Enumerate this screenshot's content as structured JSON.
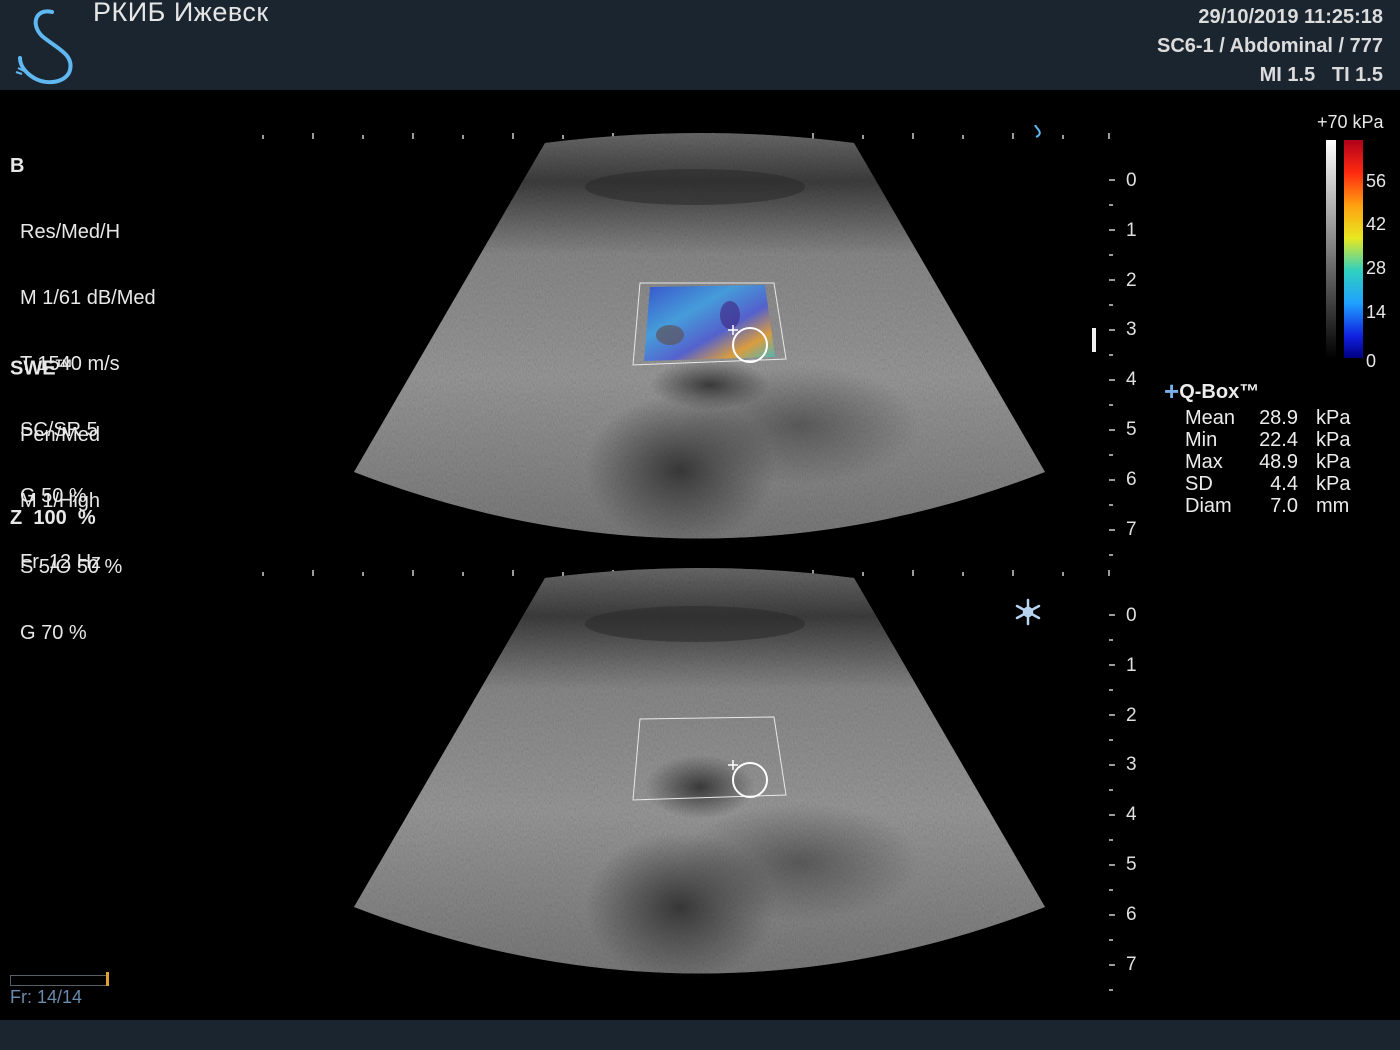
{
  "header": {
    "institution": "РКИБ Ижевск",
    "datetime": "29/10/2019 11:25:18",
    "probe_preset": "SC6-1 / Abdominal / 777",
    "indices": "MI 1.5   TI 1.5"
  },
  "b_mode": {
    "title": "B",
    "params": [
      "Res/Med/H",
      "M 1/61 dB/Med",
      "T 1540 m/s",
      "SC/SR 5",
      "G 50 %",
      "Fr. 12 Hz"
    ]
  },
  "swe": {
    "title": "SWE",
    "tm": "TM",
    "params": [
      "Pen/Med",
      "M 1/High",
      "S 5/O 50 %",
      "G 70 %"
    ]
  },
  "zoom": "Z  100  %",
  "depth_scale": {
    "upper": [
      "0",
      "1",
      "2",
      "3",
      "4",
      "5",
      "6",
      "7"
    ],
    "lower": [
      "0",
      "1",
      "2",
      "3",
      "4",
      "5",
      "6",
      "7"
    ]
  },
  "colorbar": {
    "max_label": "+70 kPa",
    "ticks": [
      "56",
      "42",
      "28",
      "14",
      "0"
    ]
  },
  "qbox": {
    "title": "Q-Box™",
    "rows": [
      {
        "key": "Mean",
        "value": "28.9",
        "unit": "kPa"
      },
      {
        "key": "Min",
        "value": "22.4",
        "unit": "kPa"
      },
      {
        "key": "Max",
        "value": "48.9",
        "unit": "kPa"
      },
      {
        "key": "SD",
        "value": "4.4",
        "unit": "kPa"
      },
      {
        "key": "Diam",
        "value": "7.0",
        "unit": "mm"
      }
    ]
  },
  "frame_info": "Fr: 14/14",
  "icons": {
    "logo": "supersonic-logo",
    "freeze": "snowflake-icon",
    "qbox_marker": "plus-icon"
  },
  "colors": {
    "header_bg": "#1b2530",
    "accent": "#5fb8f0",
    "frame_text": "#6b8aad"
  }
}
